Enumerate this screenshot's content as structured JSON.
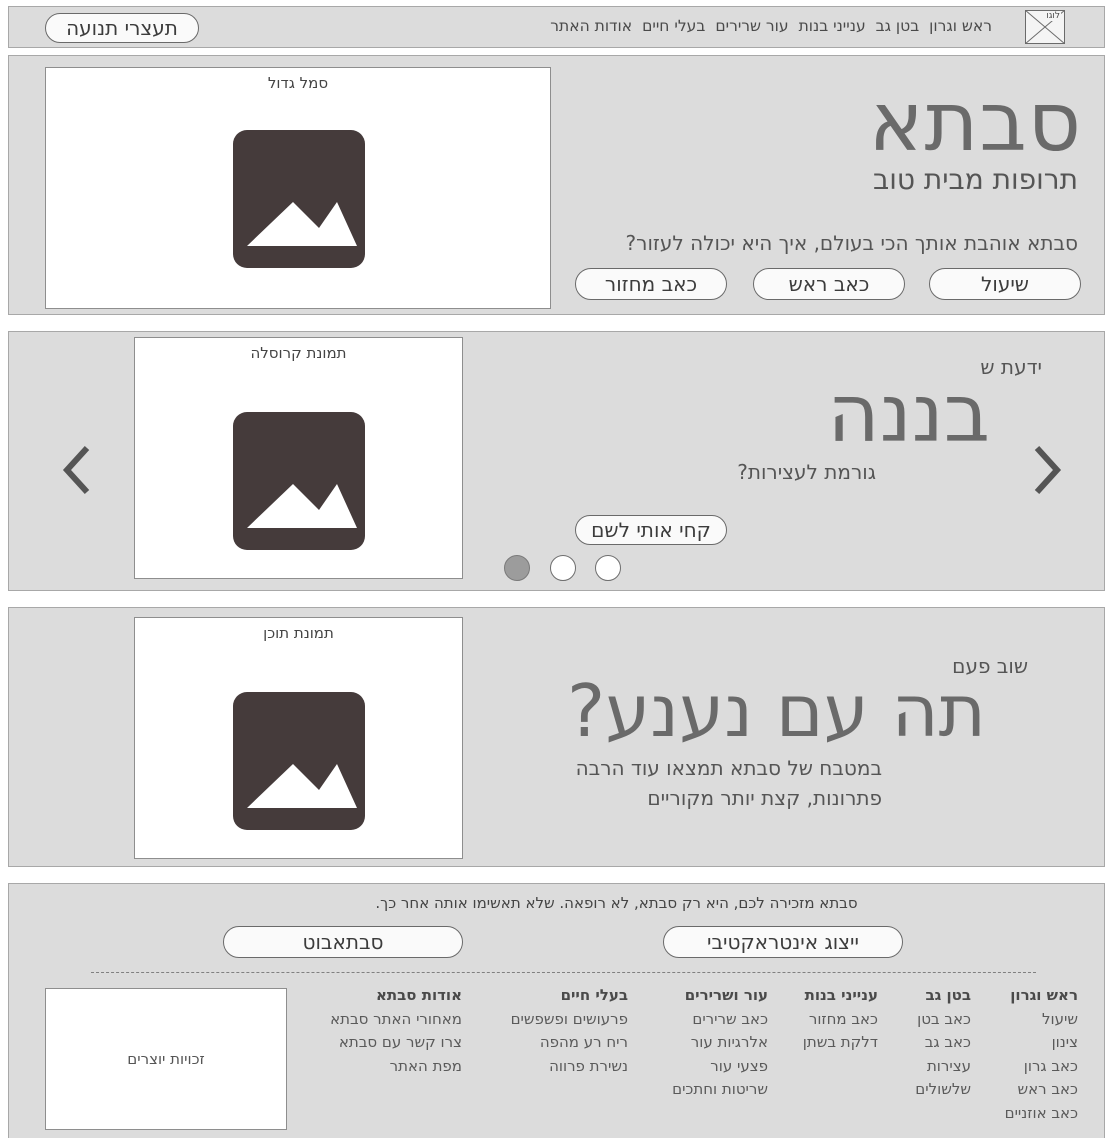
{
  "header": {
    "logo_text": "לוגו",
    "nav": [
      "ראש וגרון",
      "בטן גב",
      "ענייני בנות",
      "עור שרירים",
      "בעלי חיים",
      "אודות האתר"
    ],
    "cta": "תעצרי תנועה"
  },
  "hero": {
    "title": "סבתא",
    "subtitle": "תרופות מבית טוב",
    "question": "?סבתא אוהבת אותך הכי בעולם, איך היא יכולה לעזור",
    "buttons": [
      "שיעול",
      "כאב ראש",
      "כאב מחזור"
    ],
    "image_caption": "סמל גדול"
  },
  "carousel": {
    "kicker": "ידעת ש",
    "title": "בננה",
    "text": "?גורמת לעצירות",
    "button": "קחי אותי לשם",
    "image_caption": "תמונת קרוסלה",
    "prev_icon": "chevron-left-icon",
    "next_icon": "chevron-right-icon",
    "active_dot": 0
  },
  "feature": {
    "kicker": "שוב פעם",
    "title": "?תה עם נענע",
    "line1": "במטבח של סבתא תמצאו עוד הרבה",
    "line2": "פתרונות, קצת יותר מקוריים",
    "image_caption": "תמונת תוכן"
  },
  "footer": {
    "disclaimer": ".סבתא מזכירה לכם, היא רק סבתא, לא רופאה. שלא תאשימו אותה אחר כך",
    "buttons": [
      "ייצוג אינטראקטיבי",
      "סבתאבוט"
    ],
    "columns": [
      {
        "title": "ראש וגרון",
        "items": [
          "שיעול",
          "צינון",
          "כאב גרון",
          "כאב ראש",
          "כאב אוזניים"
        ]
      },
      {
        "title": "בטן גב",
        "items": [
          "כאב בטן",
          "כאב גב",
          "עצירות",
          "שלשולים"
        ]
      },
      {
        "title": "ענייני בנות",
        "items": [
          "כאב מחזור",
          "דלקת בשתן"
        ]
      },
      {
        "title": "עור ושרירים",
        "items": [
          "כאב שרירים",
          "אלרגיות עור",
          "פצעי עור",
          "שריטות וחתכים"
        ]
      },
      {
        "title": "בעלי חיים",
        "items": [
          "פרעושים ופשפשים",
          "ריח רע מהפה",
          "נשירת פרווה"
        ]
      },
      {
        "title": "אודות סבתא",
        "items": [
          "מאחורי האתר סבתא",
          "צרו קשר עם סבתא",
          "מפת האתר"
        ]
      }
    ],
    "copyright": "זכויות יוצרים"
  },
  "colors": {
    "panel_bg": "#dcdcdc",
    "border": "#a8a8a8",
    "image_placeholder": "#453b3b",
    "text": "#4a4a4a",
    "active_dot": "#9c9c9c"
  }
}
